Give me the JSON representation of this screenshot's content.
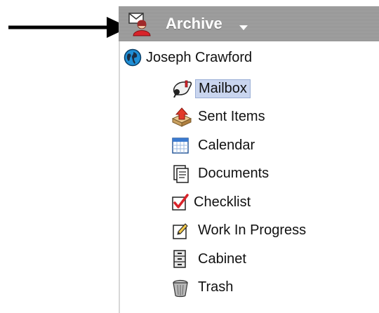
{
  "header": {
    "title": "Archive",
    "icon": "archive-envelope-person-icon",
    "background_color": "#9b9b9b"
  },
  "root": {
    "label": "Joseph Crawford",
    "icon": "globe-icon"
  },
  "folders": [
    {
      "label": "Mailbox",
      "icon": "mailbox-icon",
      "selected": true
    },
    {
      "label": "Sent Items",
      "icon": "sent-items-icon",
      "selected": false
    },
    {
      "label": "Calendar",
      "icon": "calendar-icon",
      "selected": false
    },
    {
      "label": "Documents",
      "icon": "documents-icon",
      "selected": false
    },
    {
      "label": "Checklist",
      "icon": "checklist-icon",
      "selected": false
    },
    {
      "label": "Work In Progress",
      "icon": "work-in-progress-icon",
      "selected": false
    },
    {
      "label": "Cabinet",
      "icon": "cabinet-icon",
      "selected": false
    },
    {
      "label": "Trash",
      "icon": "trash-icon",
      "selected": false
    }
  ],
  "colors": {
    "selection_background": "#c9d5ef",
    "selection_border": "#9aaed6"
  }
}
